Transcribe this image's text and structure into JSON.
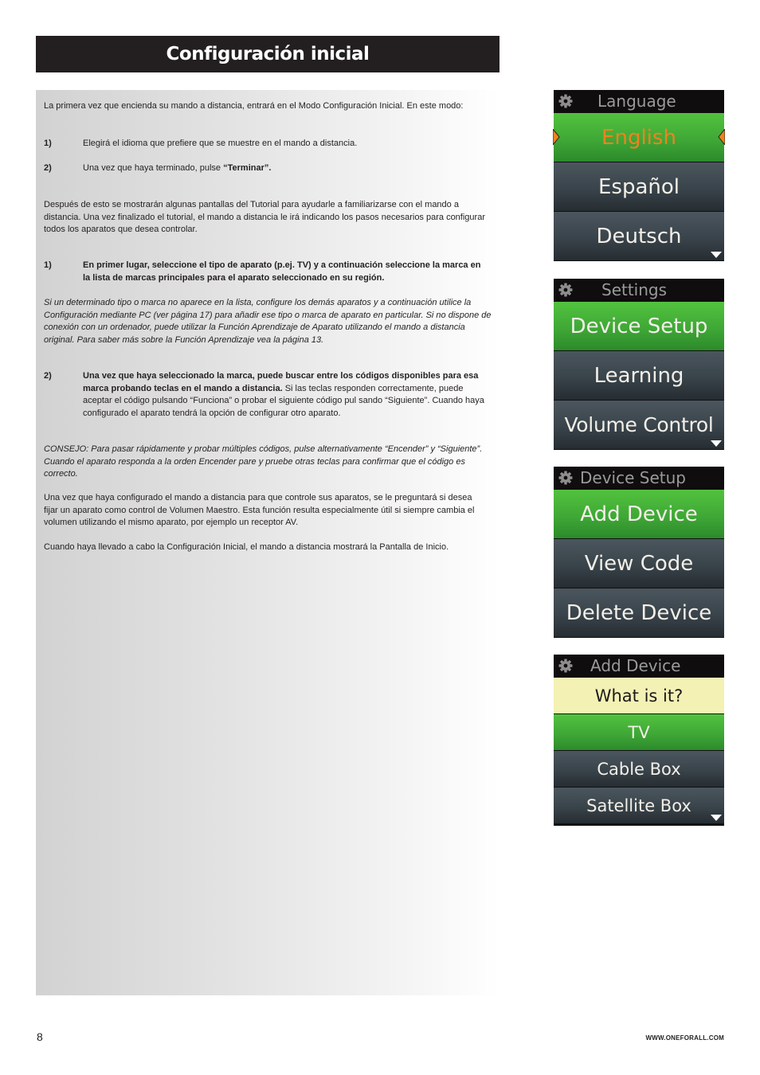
{
  "header": {
    "title": "Configuración inicial"
  },
  "body": {
    "intro": "La primera vez que encienda su mando a distancia, entrará en el Modo Configuración Inicial. En este modo:",
    "steps_a": [
      {
        "num": "1)",
        "text": "Elegirá el idioma que prefiere que se muestre en el mando a distancia."
      },
      {
        "num": "2)",
        "text_pre": "Una vez que haya terminado, pulse ",
        "text_bold": "“Terminar”."
      }
    ],
    "after_tutorial": "Después de esto se mostrarán algunas pantallas del Tutorial para ayudarle a familiarizarse con el mando a distancia. Una vez finalizado el tutorial, el mando a distancia le irá indicando los pasos necesarios para configurar todos los aparatos que desea controlar.",
    "steps_b": [
      {
        "num": "1)",
        "text_bold": "En primer lugar, seleccione el tipo de aparato (p.ej. TV) y a continuación seleccione la marca en la lista de marcas principales para el aparato seleccionado en su región."
      },
      {
        "num": "2)",
        "text_bold": "Una vez que haya seleccionado la marca, puede buscar entre los códigos disponibles para esa marca probando teclas en el mando a distancia.",
        "text": " Si las teclas responden correctamente, puede aceptar el código pulsando “Funciona” o probar el siguiente código pul sando “Siguiente”. Cuando haya configurado el aparato tendrá la opción de configurar otro aparato."
      }
    ],
    "note_italic": "Si un determinado tipo o marca no aparece en la lista, configure los demás aparatos y a continuación utilice la Configuración mediante PC (ver página 17) para añadir ese tipo o marca de aparato en particular. Si no dispone de conexión con un ordenador, puede utilizar la Función Aprendizaje de Aparato utilizando el mando a distancia original. Para saber más sobre la Función Aprendizaje vea la página 13.",
    "tip_italic": "CONSEJO: Para pasar rápidamente y probar múltiples códigos, pulse alternativamente “Encender” y “Siguiente”. Cuando el aparato responda a la orden Encender pare y pruebe otras teclas para confirmar que el código es correcto.",
    "volume_para": "Una vez que haya configurado el mando a distancia para que controle sus aparatos, se le preguntará si desea fijar un aparato como control de Volumen Maestro. Esta función resulta especialmente útil si siempre cambia el volumen utilizando el mismo aparato, por ejemplo un receptor AV.",
    "final_para": "Cuando haya llevado a cabo la Configuración Inicial, el mando a distancia mostrará la Pantalla de Inicio."
  },
  "screens": [
    {
      "header": "Language",
      "items": [
        {
          "label": "English",
          "style": "green-selected"
        },
        {
          "label": "Español",
          "style": "dark"
        },
        {
          "label": "Deutsch",
          "style": "dark"
        }
      ],
      "more_indicator": true
    },
    {
      "header": "Settings",
      "items": [
        {
          "label": "Device Setup",
          "style": "green"
        },
        {
          "label": "Learning",
          "style": "dark"
        },
        {
          "label": "Volume Control",
          "style": "dark"
        }
      ],
      "more_indicator": true
    },
    {
      "header": "Device Setup",
      "items": [
        {
          "label": "Add Device",
          "style": "green"
        },
        {
          "label": "View Code",
          "style": "dark"
        },
        {
          "label": "Delete Device",
          "style": "dark"
        }
      ],
      "more_indicator": false
    },
    {
      "header": "Add Device",
      "prompt": "What is it?",
      "items": [
        {
          "label": "TV",
          "style": "green"
        },
        {
          "label": "Cable Box",
          "style": "dark"
        },
        {
          "label": "Satellite Box",
          "style": "dark"
        }
      ],
      "more_indicator": true
    }
  ],
  "colors": {
    "title_bg": "#231f20",
    "green": "#4cb83b",
    "dark_item": "#3b454c",
    "selected_text": "#f0821e",
    "prompt_bg": "#f4f1b5"
  },
  "footer": {
    "page_number": "8",
    "website": "WWW.ONEFORALL.COM"
  }
}
